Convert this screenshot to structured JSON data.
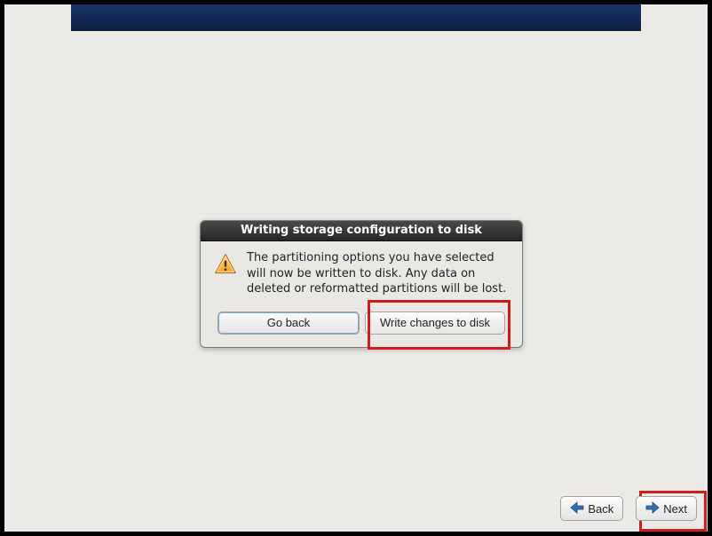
{
  "dialog": {
    "title": "Writing storage configuration to disk",
    "message": "The partitioning options you have selected will now be written to disk.  Any data on deleted or reformatted partitions will be lost.",
    "go_back_label": "Go back",
    "write_label": "Write changes to disk"
  },
  "nav": {
    "back_label": "Back",
    "next_label": "Next"
  }
}
